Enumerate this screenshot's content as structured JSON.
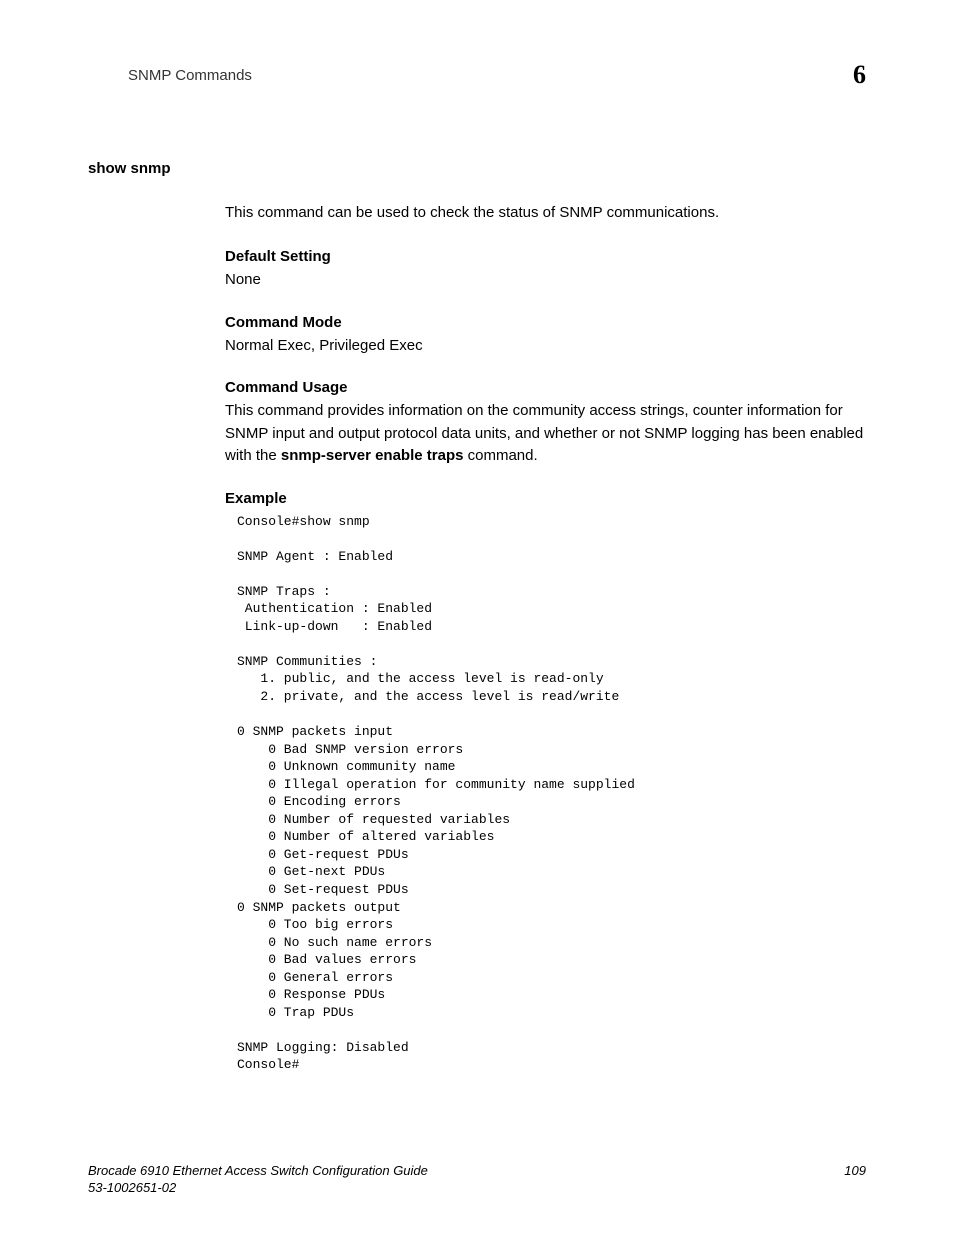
{
  "header": {
    "title": "SNMP Commands",
    "chapter_number": "6"
  },
  "section": {
    "heading": "show snmp",
    "description": "This command can be used to check the status of SNMP communications."
  },
  "default_setting": {
    "title": "Default Setting",
    "text": "None"
  },
  "command_mode": {
    "title": "Command Mode",
    "text": "Normal Exec, Privileged Exec"
  },
  "command_usage": {
    "title": "Command Usage",
    "text_before_bold": "This command provides information on the community access strings, counter information for SNMP input and output protocol data units, and whether or not SNMP logging has been enabled with the ",
    "bold_text": "snmp-server enable traps",
    "text_after_bold": " command."
  },
  "example": {
    "title": "Example",
    "code": "Console#show snmp\n\nSNMP Agent : Enabled\n\nSNMP Traps :\n Authentication : Enabled\n Link-up-down   : Enabled\n\nSNMP Communities :\n   1. public, and the access level is read-only\n   2. private, and the access level is read/write\n\n0 SNMP packets input\n    0 Bad SNMP version errors\n    0 Unknown community name\n    0 Illegal operation for community name supplied\n    0 Encoding errors\n    0 Number of requested variables\n    0 Number of altered variables\n    0 Get-request PDUs\n    0 Get-next PDUs\n    0 Set-request PDUs\n0 SNMP packets output\n    0 Too big errors\n    0 No such name errors\n    0 Bad values errors\n    0 General errors\n    0 Response PDUs\n    0 Trap PDUs\n\nSNMP Logging: Disabled\nConsole#"
  },
  "footer": {
    "guide_title": "Brocade 6910 Ethernet Access Switch Configuration Guide",
    "part_number": "53-1002651-02",
    "page_number": "109"
  }
}
